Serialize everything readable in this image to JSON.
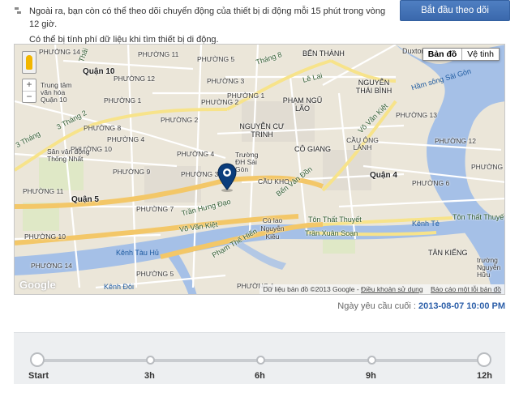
{
  "info": {
    "line1": "Ngoài ra, bạn còn có thể theo dõi chuyển động của thiết bị di động mỗi 15 phút trong vòng 12 giờ.",
    "line2": "Có thể bị tính phí dữ liệu khi tìm thiết bị di động."
  },
  "start_button": "Bắt đầu theo dõi",
  "map": {
    "map_type_buttons": [
      "Bản đồ",
      "Vệ tinh"
    ],
    "zoom_in": "+",
    "zoom_out": "−",
    "logo": "Google",
    "attribution": "Dữ liệu bản đồ ©2013 Google",
    "terms_link": "Điều khoản sử dụng",
    "report_link": "Báo cáo một lỗi bản đồ",
    "labels": {
      "quan10": "Quận 10",
      "quan5": "Quận 5",
      "quan4": "Quận 4",
      "phuong14a": "PHƯỜNG 14",
      "phuong12a": "PHƯỜNG 12",
      "phuong11a": "PHƯỜNG 11",
      "phuong5a": "PHƯỜNG 5",
      "phuong3a": "PHƯỜNG 3",
      "phuong1a": "PHƯỜNG 1",
      "phuong4a": "PHƯỜNG 4",
      "phuong9a": "PHƯỜNG 9",
      "phuong3b": "PHƯỜNG 3",
      "phuong2a": "PHƯỜNG 2",
      "phuong8a": "PHƯỜNG 8",
      "phuong7a": "PHƯỜNG 7",
      "phuong10a": "PHƯỜNG 10",
      "phuong11b": "PHƯỜNG 11",
      "phuong9b": "PHƯỜNG 9",
      "phuong12b": "PHƯỜNG 12",
      "phuong13": "PHƯỜNG 13",
      "phuong6a": "PHƯỜNG 6",
      "phuong2b": "PHƯỜNG 2",
      "phuong4b": "PHƯỜNG 4",
      "phuong1b": "PHƯỜNG 1",
      "ben_thanh": "BẾN THÀNH",
      "nguyen_thai_binh": "NGUYỄN THÁI BÌNH",
      "pham_ngu_lao": "PHẠM NGŨ LÃO",
      "nguyen_cu_trinh": "NGUYỄN CƯ TRINH",
      "cau_kho": "CẦU KHO",
      "co_giang": "CÔ GIANG",
      "cau_ong_lanh": "CẦU ÔNG LÃNH",
      "tan_kieng": "TÂN KIỂNG",
      "duxton": "Duxton",
      "truong_dh": "Trường ĐH Sài Gòn",
      "truong_nguyen_huu": "trường Nguyễn Hữu",
      "san_van_dong": "Sân vận động Thống Nhất",
      "trung_tam_van_hoa": "Trung tâm văn hóa Quận 10",
      "cu_lao": "Cù lao Nguyễn Kiều",
      "ben_nghe": "Bến Nghé",
      "ham_song_sai_gon": "Hầm sông Sài Gòn",
      "kenh_te": "Kênh Tẻ",
      "kenh_tau_hu": "Kênh Tàu Hủ",
      "kenh_doi": "Kênh Đôi",
      "road_3thang2": "3 Tháng 2",
      "road_3thang2b": "3 Tháng 2",
      "road_thang8": "Tháng 8",
      "road_3thang": "3 Tháng",
      "road_le_lai": "Lê Lai",
      "road_vo_van_kiet": "Võ Văn Kiệt",
      "road_vo_van_kiet2": "Võ Văn Kiệt",
      "road_tran_hung_dao": "Trần Hưng Đạo",
      "road_ben_van_don": "Bến Vân Đồn",
      "road_ton_that_thuyet": "Tôn Thất Thuyết",
      "road_ton_that_thuyet2": "Tôn Thất Thuyết",
      "road_tran_xuan_soan": "Trần Xuân Soạn",
      "road_pham_the_hien": "Phạm Thế Hiển",
      "road_thai": "Thái"
    }
  },
  "request": {
    "label": "Ngày yêu cầu cuối :",
    "value": "2013-08-07 10:00 PM"
  },
  "timeline": {
    "labels": [
      "Start",
      "3h",
      "6h",
      "9h",
      "12h"
    ]
  }
}
